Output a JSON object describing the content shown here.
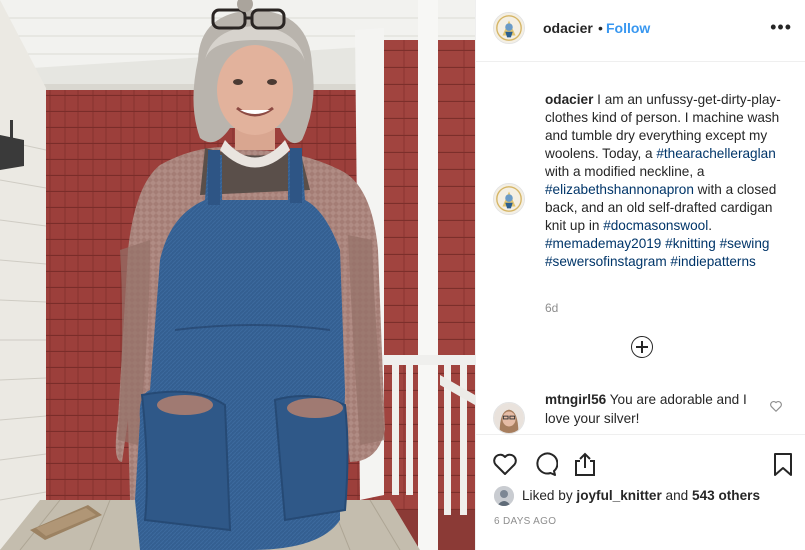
{
  "post": {
    "image_alt": "Woman wearing a denim apron over a pink knitted cardigan on a porch",
    "author": "odacier",
    "header_separator": "•",
    "follow_label": "Follow",
    "more_label": "•••",
    "caption": {
      "username": "odacier",
      "segments": [
        {
          "text": " I am an unfussy-get-dirty-play-clothes kind of person. I machine wash and tumble dry everything except my woolens. Today, a ",
          "tag": false
        },
        {
          "text": "#thearachelleraglan",
          "tag": true
        },
        {
          "text": " with a modified neckline, a ",
          "tag": false
        },
        {
          "text": "#elizabethshannonapron",
          "tag": true
        },
        {
          "text": " with a closed back, and an old self-drafted cardigan knit up in ",
          "tag": false
        },
        {
          "text": "#docmasonswool",
          "tag": true
        },
        {
          "text": ". ",
          "tag": false
        },
        {
          "text": "#memademay2019",
          "tag": true
        },
        {
          "text": " ",
          "tag": false
        },
        {
          "text": "#knitting",
          "tag": true
        },
        {
          "text": " ",
          "tag": false
        },
        {
          "text": "#sewing",
          "tag": true
        },
        {
          "text": " ",
          "tag": false
        },
        {
          "text": "#sewersofinstagram",
          "tag": true
        },
        {
          "text": " ",
          "tag": false
        },
        {
          "text": "#indiepatterns",
          "tag": true
        }
      ],
      "time": "6d"
    },
    "comments": [
      {
        "username": "mtngirl56",
        "text": " You are adorable and I love your silver!"
      }
    ],
    "likes": {
      "prefix": "Liked by ",
      "first_liker": "joyful_knitter",
      "middle": " and ",
      "others": "543 others"
    },
    "age": "6 DAYS AGO"
  },
  "icons": {
    "like": "heart-icon",
    "comment": "comment-icon",
    "share": "share-icon",
    "save": "bookmark-icon",
    "load_more": "plus-circle-icon",
    "more": "more-options-icon"
  },
  "colors": {
    "link": "#3897f0",
    "hashtag": "#003569",
    "muted": "#8e8e8e",
    "text": "#262626",
    "border": "#efefef"
  }
}
